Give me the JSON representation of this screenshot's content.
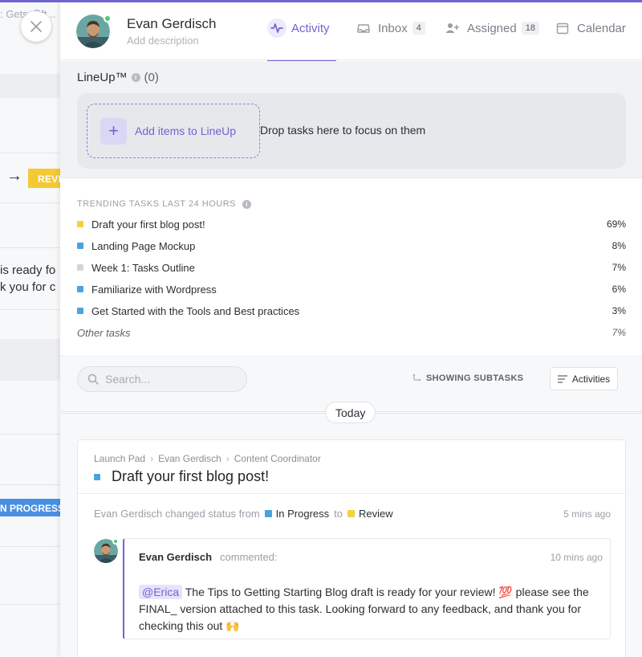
{
  "background": {
    "crumb_text": ": Getsₜ Ↄft ..",
    "review_badge": "REVI",
    "text_line_1": "is ready fo",
    "text_line_2": "k you for c",
    "progress_badge": "N PROGRESS"
  },
  "header": {
    "user_name": "Evan Gerdisch",
    "description_placeholder": "Add description",
    "tabs": [
      {
        "label": "Activity",
        "icon": "activity-pulse-icon",
        "active": true
      },
      {
        "label": "Inbox",
        "icon": "inbox-tray-icon",
        "count": "4"
      },
      {
        "label": "Assigned",
        "icon": "assigned-user-icon",
        "count": "18"
      },
      {
        "label": "Calendar",
        "icon": "calendar-icon"
      }
    ]
  },
  "lineup": {
    "title": "LineUp™",
    "count": "(0)",
    "add_label": "Add items to LineUp",
    "drop_hint": "Drop tasks here to focus on them"
  },
  "trending": {
    "title": "TRENDING TASKS LAST 24 HOURS",
    "tasks": [
      {
        "name": "Draft your first blog post!",
        "percent": "69%",
        "color": "#f3d23c"
      },
      {
        "name": "Landing Page Mockup",
        "percent": "8%",
        "color": "#4aa3df"
      },
      {
        "name": "Week 1: Tasks Outline",
        "percent": "7%",
        "color": "#d3d5d9"
      },
      {
        "name": "Familiarize with Wordpress",
        "percent": "6%",
        "color": "#4aa3df"
      },
      {
        "name": "Get Started with the Tools and Best practices",
        "percent": "3%",
        "color": "#4aa3df"
      }
    ],
    "other": {
      "name": "Other tasks",
      "percent": "7%"
    }
  },
  "toolbar": {
    "search_placeholder": "Search...",
    "subtasks_label": "SHOWING SUBTASKS",
    "activities_label": "Activities"
  },
  "feed": {
    "day_label": "Today",
    "card": {
      "breadcrumb": [
        "Launch Pad",
        "Evan Gerdisch",
        "Content Coordinator"
      ],
      "title": "Draft your first blog post!",
      "status_change": {
        "prefix": "Evan Gerdisch changed status from",
        "from": "In Progress",
        "from_color": "#4aa3df",
        "connector": "to",
        "to": "Review",
        "to_color": "#f3d23c",
        "time": "5 mins ago"
      },
      "comment": {
        "author": "Evan Gerdisch",
        "action": "commented:",
        "time": "10 mins ago",
        "mention": "@Erica",
        "text": " The Tips to Getting Starting Blog draft is ready for your review! 💯 please see the FINAL_ version attached to this task. Looking forward to any feedback, and thank you for checking this out 🙌"
      }
    }
  },
  "colors": {
    "accent": "#6f65d1",
    "online": "#46c97a"
  }
}
